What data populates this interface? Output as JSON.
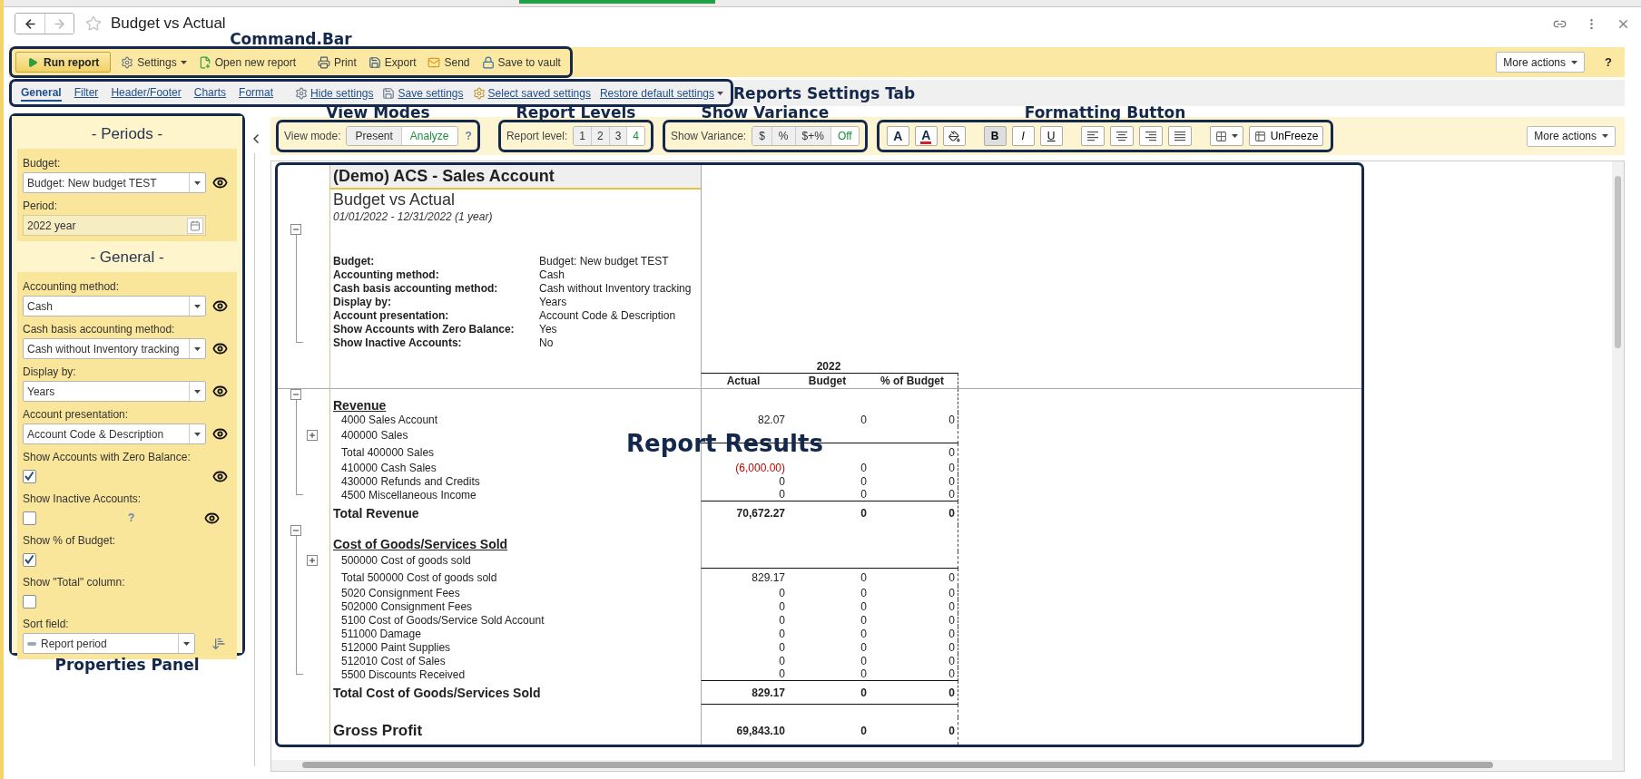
{
  "window": {
    "title": "Budget vs Actual"
  },
  "command_bar": {
    "callout": "Command.Bar",
    "more_actions": "More actions",
    "help": "?",
    "buttons": [
      {
        "label": "Run report",
        "kind": "primary"
      },
      {
        "label": "Settings",
        "kind": "menu"
      },
      {
        "label": "Open new report",
        "kind": "plain"
      },
      {
        "label": "Print",
        "kind": "plain"
      },
      {
        "label": "Export",
        "kind": "plain"
      },
      {
        "label": "Send",
        "kind": "plain"
      },
      {
        "label": "Save to vault",
        "kind": "plain"
      }
    ]
  },
  "settings_tabs": {
    "callout": "Reports Settings Tab",
    "tabs": [
      {
        "label": "General",
        "selected": true
      },
      {
        "label": "Filter",
        "selected": false
      },
      {
        "label": "Header/Footer",
        "selected": false
      },
      {
        "label": "Charts",
        "selected": false
      },
      {
        "label": "Format",
        "selected": false
      }
    ],
    "actions": [
      {
        "label": "Hide settings",
        "kind": "plain"
      },
      {
        "label": "Save settings",
        "kind": "plain"
      },
      {
        "label": "Select saved settings",
        "kind": "plain"
      },
      {
        "label": "Restore default settings",
        "kind": "menu"
      }
    ]
  },
  "properties_panel": {
    "callout": "Properties Panel",
    "sections": [
      {
        "title": "- Periods -",
        "fields": [
          {
            "kind": "select",
            "label": "Budget:",
            "value": "Budget: New budget TEST",
            "in_header": true
          },
          {
            "kind": "period",
            "label": "Period:",
            "value": "2022 year",
            "in_header": false
          }
        ]
      },
      {
        "title": "- General -",
        "fields": [
          {
            "kind": "select",
            "label": "Accounting method:",
            "value": "Cash",
            "in_header": true
          },
          {
            "kind": "select",
            "label": "Cash basis accounting method:",
            "value": "Cash without Inventory tracking",
            "in_header": true
          },
          {
            "kind": "select",
            "label": "Display by:",
            "value": "Years",
            "in_header": true
          },
          {
            "kind": "select",
            "label": "Account presentation:",
            "value": "Account Code & Description",
            "in_header": true
          },
          {
            "kind": "checkbox",
            "label": "Show Accounts with Zero Balance:",
            "checked": true,
            "in_header": true
          },
          {
            "kind": "checkbox",
            "label": "Show Inactive Accounts:",
            "checked": false,
            "help": "?",
            "in_header": true
          },
          {
            "kind": "checkbox",
            "label": "Show % of Budget:",
            "checked": true,
            "in_header": false
          },
          {
            "kind": "checkbox",
            "label": "Show \"Total\" column:",
            "checked": false,
            "in_header": false
          },
          {
            "kind": "sort",
            "label": "Sort field:",
            "value": "Report period",
            "in_header": false
          }
        ]
      }
    ]
  },
  "report_toolbar": {
    "more_actions": "More actions",
    "view_mode": {
      "callout": "View Modes",
      "label": "View mode:",
      "help": "?",
      "options": [
        {
          "label": "Present",
          "selected": false
        },
        {
          "label": "Analyze",
          "selected": true
        }
      ]
    },
    "report_level": {
      "callout": "Report Levels",
      "label": "Report level:",
      "options": [
        {
          "label": "1",
          "selected": false
        },
        {
          "label": "2",
          "selected": false
        },
        {
          "label": "3",
          "selected": false
        },
        {
          "label": "4",
          "selected": true
        }
      ]
    },
    "show_variance": {
      "callout": "Show Variance",
      "label": "Show Variance:",
      "options": [
        {
          "label": "$",
          "selected": false
        },
        {
          "label": "%",
          "selected": false
        },
        {
          "label": "$+%",
          "selected": false
        },
        {
          "label": "Off",
          "selected": true
        }
      ]
    },
    "formatting": {
      "callout": "Formatting Button",
      "buttons": [
        {
          "kind": "font",
          "label": "A"
        },
        {
          "kind": "fontcolor",
          "label": "A"
        },
        {
          "kind": "fill"
        },
        {
          "kind": "bold",
          "label": "B",
          "selected": true
        },
        {
          "kind": "italic",
          "label": "I",
          "selected": false
        },
        {
          "kind": "underline",
          "label": "U",
          "selected": false
        },
        {
          "kind": "left"
        },
        {
          "kind": "center"
        },
        {
          "kind": "right"
        },
        {
          "kind": "justify"
        },
        {
          "kind": "borders"
        },
        {
          "kind": "unfreeze",
          "label": "UnFreeze"
        }
      ]
    }
  },
  "report": {
    "callout": "Report Results",
    "company": "(Demo) ACS - Sales Account",
    "title": "Budget vs Actual",
    "period": "01/01/2022 - 12/31/2022 (1 year)",
    "parameters_expanded": true,
    "parameters": [
      {
        "label": "Budget:",
        "value": "Budget: New budget TEST"
      },
      {
        "label": "Accounting method:",
        "value": "Cash"
      },
      {
        "label": "Cash basis accounting method:",
        "value": "Cash without Inventory tracking"
      },
      {
        "label": "Display by:",
        "value": "Years"
      },
      {
        "label": "Account presentation:",
        "value": "Account Code & Description"
      },
      {
        "label": "Show Accounts with Zero Balance:",
        "value": "Yes"
      },
      {
        "label": "Show Inactive Accounts:",
        "value": "No"
      }
    ],
    "column_group": "2022",
    "columns": [
      "Actual",
      "Budget",
      "% of Budget"
    ],
    "sections": [
      {
        "title": "Revenue",
        "expanded": true,
        "rows": [
          {
            "kind": "account",
            "label": "4000 Sales Account",
            "underline": false,
            "values": {
              "actual": {
                "text": "82.07",
                "negative": false
              },
              "budget": {
                "text": "0",
                "negative": false
              },
              "percent": {
                "text": "0",
                "negative": false
              }
            }
          },
          {
            "kind": "group",
            "label": "400000 Sales",
            "expanded": false,
            "underline": true
          },
          {
            "kind": "subtotal",
            "label": "Total 400000 Sales",
            "underline": false,
            "values": {
              "percent": {
                "text": "0",
                "negative": false
              }
            }
          },
          {
            "kind": "account",
            "label": "410000 Cash Sales",
            "underline": false,
            "values": {
              "actual": {
                "text": "(6,000.00)",
                "negative": true
              },
              "budget": {
                "text": "0",
                "negative": false
              },
              "percent": {
                "text": "0",
                "negative": false
              }
            }
          },
          {
            "kind": "account",
            "label": "430000 Refunds and Credits",
            "underline": false,
            "values": {
              "actual": {
                "text": "0",
                "negative": false
              },
              "budget": {
                "text": "0",
                "negative": false
              },
              "percent": {
                "text": "0",
                "negative": false
              }
            }
          },
          {
            "kind": "account",
            "label": "4500 Miscellaneous Income",
            "underline": true,
            "values": {
              "actual": {
                "text": "0",
                "negative": false
              },
              "budget": {
                "text": "0",
                "negative": false
              },
              "percent": {
                "text": "0",
                "negative": false
              }
            }
          }
        ],
        "total": {
          "label": "Total Revenue",
          "underline": false,
          "values": {
            "actual": {
              "text": "70,672.27",
              "negative": false
            },
            "budget": {
              "text": "0",
              "negative": false
            },
            "percent": {
              "text": "0",
              "negative": false
            }
          }
        }
      },
      {
        "title": "Cost of Goods/Services Sold",
        "expanded": true,
        "rows": [
          {
            "kind": "group",
            "label": "500000 Cost of goods sold",
            "expanded": false,
            "underline": true
          },
          {
            "kind": "subtotal",
            "label": "Total 500000 Cost of goods sold",
            "underline": false,
            "values": {
              "actual": {
                "text": "829.17",
                "negative": false
              },
              "budget": {
                "text": "0",
                "negative": false
              },
              "percent": {
                "text": "0",
                "negative": false
              }
            }
          },
          {
            "kind": "account",
            "label": "5020 Consignment Fees",
            "underline": false,
            "values": {
              "actual": {
                "text": "0",
                "negative": false
              },
              "budget": {
                "text": "0",
                "negative": false
              },
              "percent": {
                "text": "0",
                "negative": false
              }
            }
          },
          {
            "kind": "account",
            "label": "502000 Consignment Fees",
            "underline": false,
            "values": {
              "actual": {
                "text": "0",
                "negative": false
              },
              "budget": {
                "text": "0",
                "negative": false
              },
              "percent": {
                "text": "0",
                "negative": false
              }
            }
          },
          {
            "kind": "account",
            "label": "5100 Cost of Goods/Service Sold Account",
            "underline": false,
            "values": {
              "actual": {
                "text": "0",
                "negative": false
              },
              "budget": {
                "text": "0",
                "negative": false
              },
              "percent": {
                "text": "0",
                "negative": false
              }
            }
          },
          {
            "kind": "account",
            "label": "511000 Damage",
            "underline": false,
            "values": {
              "actual": {
                "text": "0",
                "negative": false
              },
              "budget": {
                "text": "0",
                "negative": false
              },
              "percent": {
                "text": "0",
                "negative": false
              }
            }
          },
          {
            "kind": "account",
            "label": "512000 Paint Supplies",
            "underline": false,
            "values": {
              "actual": {
                "text": "0",
                "negative": false
              },
              "budget": {
                "text": "0",
                "negative": false
              },
              "percent": {
                "text": "0",
                "negative": false
              }
            }
          },
          {
            "kind": "account",
            "label": "512010 Cost of Sales",
            "underline": false,
            "values": {
              "actual": {
                "text": "0",
                "negative": false
              },
              "budget": {
                "text": "0",
                "negative": false
              },
              "percent": {
                "text": "0",
                "negative": false
              }
            }
          },
          {
            "kind": "account",
            "label": "5500 Discounts Received",
            "underline": true,
            "values": {
              "actual": {
                "text": "0",
                "negative": false
              },
              "budget": {
                "text": "0",
                "negative": false
              },
              "percent": {
                "text": "0",
                "negative": false
              }
            }
          }
        ],
        "total": {
          "label": "Total Cost of Goods/Services Sold",
          "underline": true,
          "values": {
            "actual": {
              "text": "829.17",
              "negative": false
            },
            "budget": {
              "text": "0",
              "negative": false
            },
            "percent": {
              "text": "0",
              "negative": false
            }
          }
        }
      }
    ],
    "grand_total": {
      "label": "Gross Profit",
      "values": {
        "actual": {
          "text": "69,843.10",
          "negative": false
        },
        "budget": {
          "text": "0",
          "negative": false
        },
        "percent": {
          "text": "0",
          "negative": false
        }
      }
    }
  }
}
